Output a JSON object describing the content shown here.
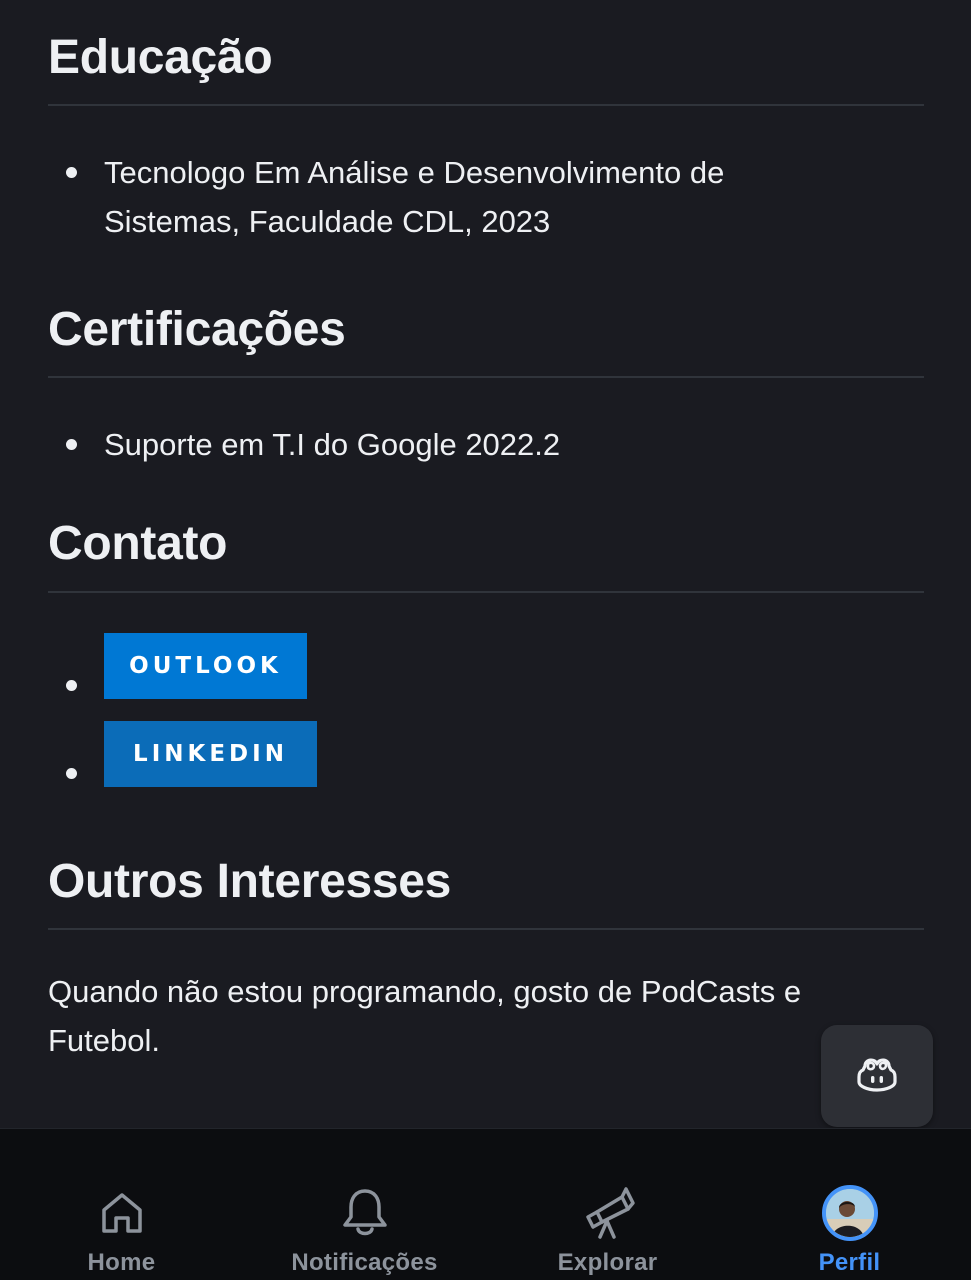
{
  "sections": {
    "education": {
      "heading": "Educação",
      "items": [
        "Tecnologo Em Análise e Desenvolvimento de Sistemas, Faculdade CDL, 2023"
      ]
    },
    "certifications": {
      "heading": "Certificações",
      "items": [
        "Suporte em T.I do Google 2022.2"
      ]
    },
    "contact": {
      "heading": "Contato",
      "badges": [
        {
          "label": "OUTLOOK",
          "color": "#0078d4"
        },
        {
          "label": "LINKEDIN",
          "color": "#0a66c2"
        }
      ]
    },
    "interests": {
      "heading": "Outros Interesses",
      "text": "Quando não estou programando, gosto de PodCasts e Futebol."
    }
  },
  "fab": {
    "icon": "copilot-icon"
  },
  "tabbar": {
    "tabs": [
      {
        "label": "Home",
        "icon": "home-icon",
        "active": false
      },
      {
        "label": "Notificações",
        "icon": "bell-icon",
        "active": false
      },
      {
        "label": "Explorar",
        "icon": "telescope-icon",
        "active": false
      },
      {
        "label": "Perfil",
        "icon": "avatar",
        "active": true
      }
    ],
    "active_color": "#4493f8",
    "inactive_color": "#8d939c"
  },
  "colors": {
    "background": "#1a1b21",
    "text": "#eef0f3",
    "divider": "#30343b"
  }
}
